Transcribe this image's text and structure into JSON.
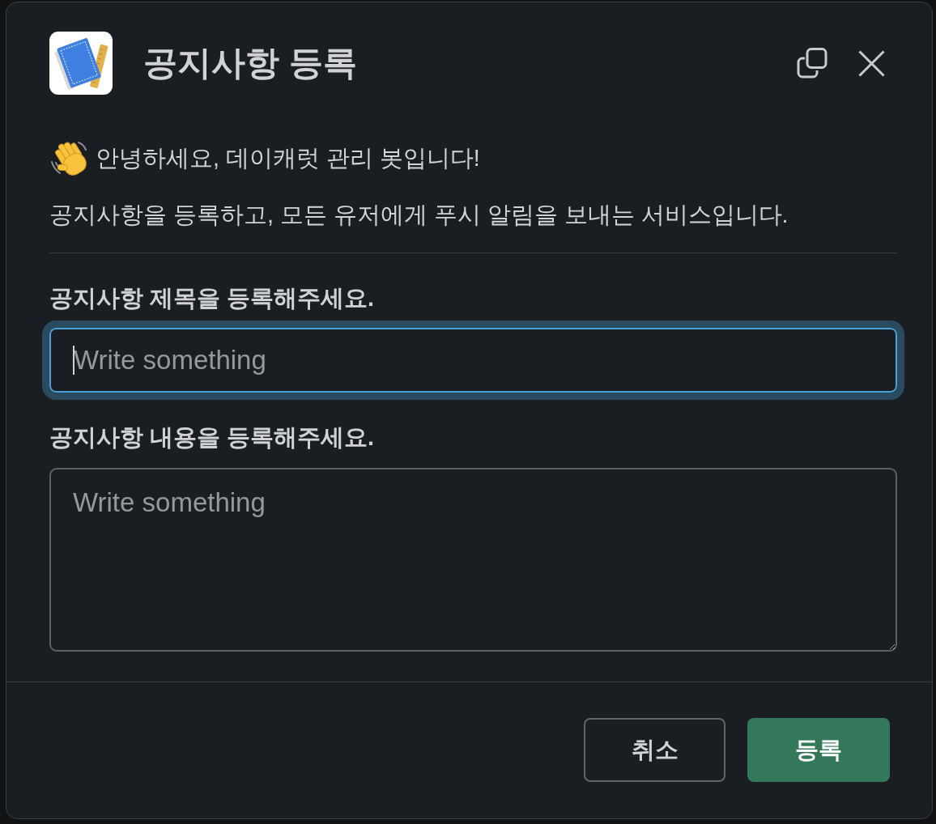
{
  "dialog": {
    "title": "공지사항 등록"
  },
  "intro": {
    "greeting": "안녕하세요, 데이캐럿 관리 봇입니다!",
    "description": "공지사항을 등록하고, 모든 유저에게 푸시 알림을 보내는 서비스입니다."
  },
  "fields": [
    {
      "kind": "input",
      "label": "공지사항 제목을 등록해주세요.",
      "placeholder": "Write something",
      "focused": true
    },
    {
      "kind": "textarea",
      "label": "공지사항 내용을 등록해주세요.",
      "placeholder": "Write something",
      "focused": false
    }
  ],
  "buttons": [
    {
      "kind": "secondary",
      "label": "취소"
    },
    {
      "kind": "primary",
      "label": "등록"
    }
  ]
}
